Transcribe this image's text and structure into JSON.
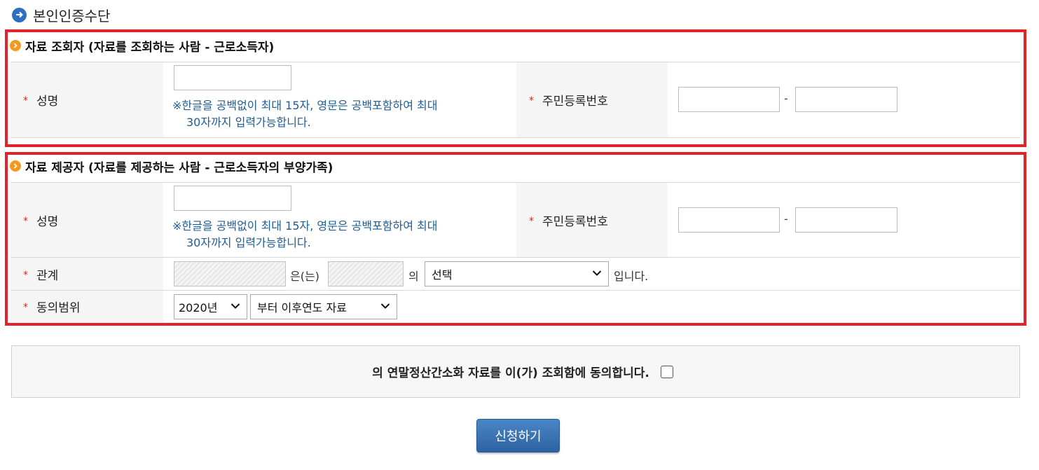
{
  "page": {
    "title": "본인인증수단"
  },
  "viewer_section": {
    "title": "자료 조회자 (자료를 조회하는 사람 - 근로소득자)",
    "name_label": "성명",
    "name_value": "",
    "name_hint_line1": "※한글을 공백없이 최대 15자, 영문은 공백포함하여 최대",
    "name_hint_line2": "30자까지 입력가능합니다.",
    "rrn_label": "주민등록번호",
    "rrn_front": "",
    "rrn_back": "",
    "dash": "-"
  },
  "provider_section": {
    "title": "자료 제공자 (자료를 제공하는 사람 - 근로소득자의 부양가족)",
    "name_label": "성명",
    "name_value": "",
    "name_hint_line1": "※한글을 공백없이 최대 15자, 영문은 공백포함하여 최대",
    "name_hint_line2": "30자까지 입력가능합니다.",
    "rrn_label": "주민등록번호",
    "rrn_front": "",
    "rrn_back": "",
    "dash": "-",
    "relation_label": "관계",
    "relation_word1": "은(는)",
    "relation_word2": "의",
    "relation_select": "선택",
    "relation_suffix": "입니다.",
    "consent_label": "동의범위",
    "year_select": "2020년",
    "range_select": "부터 이후연도 자료"
  },
  "agreement": {
    "text": "의 연말정산간소화 자료를 이(가) 조회함에 동의합니다.",
    "checked": false
  },
  "submit_label": "신청하기",
  "colors": {
    "red_border": "#e3232b",
    "hint_blue": "#1f5c94",
    "button_blue": "#2d62a2",
    "section_icon": "#f39a1e"
  }
}
